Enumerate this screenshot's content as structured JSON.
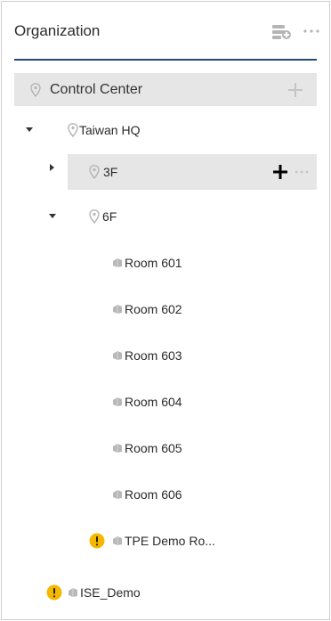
{
  "header": {
    "title": "Organization",
    "server_icon": "add-server-icon",
    "more_icon": "more-icon"
  },
  "colors": {
    "underline": "#234a7a",
    "selected_bg": "#e6e6e6",
    "warning": "#f5b800",
    "icon_gray": "#b5b5b5"
  },
  "tree": {
    "root": {
      "label": "Control Center",
      "icon": "location-pin-icon",
      "action": "add-icon"
    },
    "taiwan_hq": {
      "label": "Taiwan HQ",
      "expanded": true
    },
    "floor_3f": {
      "label": "3F",
      "expanded": false,
      "selected": true
    },
    "floor_6f": {
      "label": "6F",
      "expanded": true
    },
    "rooms": [
      {
        "label": "Room 601"
      },
      {
        "label": "Room 602"
      },
      {
        "label": "Room 603"
      },
      {
        "label": "Room 604"
      },
      {
        "label": "Room 605"
      },
      {
        "label": "Room 606"
      }
    ],
    "tpe_demo": {
      "label": "TPE Demo Ro...",
      "status": "warning"
    },
    "ise_demo": {
      "label": "ISE_Demo",
      "status": "warning"
    }
  }
}
